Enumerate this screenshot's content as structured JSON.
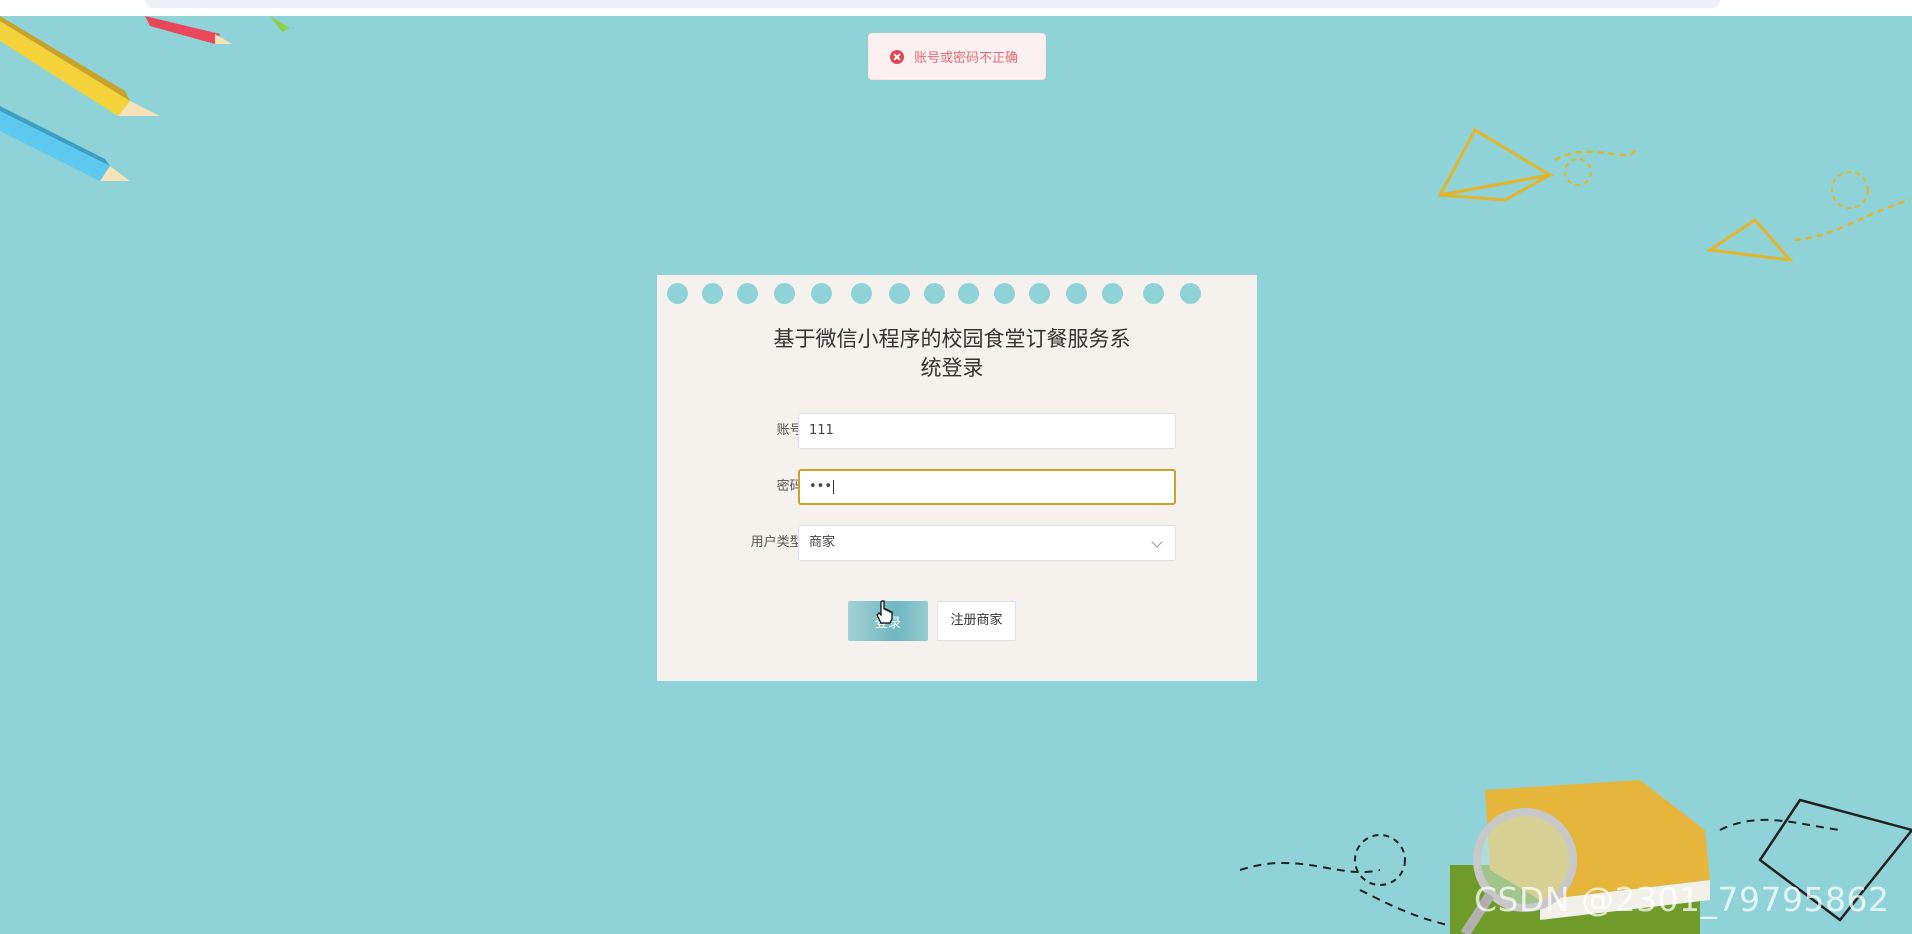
{
  "toast": {
    "message": "账号或密码不正确",
    "icon": "error-circle-icon"
  },
  "login": {
    "title_line1": "基于微信小程序的校园食堂订餐服务系",
    "title_line2": "统登录",
    "account_label": "账号:",
    "account_value": "111",
    "password_label": "密码:",
    "password_mask": "•••",
    "user_type_label": "用户类型:",
    "user_type_value": "商家",
    "login_button": "登录",
    "register_button": "注册商家"
  },
  "watermark": "CSDN @2301_79795862",
  "colors": {
    "background": "#8fd3d9",
    "card": "#f5f2ed",
    "error": "#e0465a",
    "focus": "#c9a227"
  }
}
